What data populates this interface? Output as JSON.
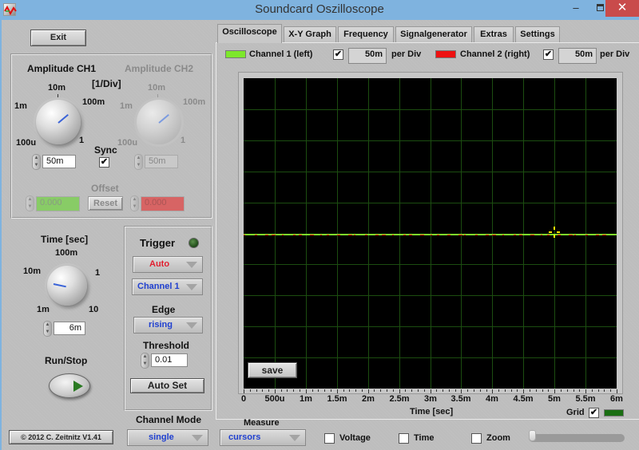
{
  "window": {
    "title": "Soundcard Oszilloscope",
    "minimize_glyph": "–",
    "close_glyph": "✕"
  },
  "left": {
    "exit_label": "Exit",
    "amplitude": {
      "ch1_title": "Amplitude CH1",
      "ch2_title": "Amplitude CH2",
      "unit_label": "[1/Div]",
      "knob_labels": [
        "100u",
        "1m",
        "10m",
        "100m",
        "1"
      ],
      "ch1_value": "50m",
      "ch2_value": "50m",
      "sync_label": "Sync",
      "sync_checked": true,
      "offset_label": "Offset",
      "offset_ch1": "0.000",
      "offset_ch2": "0.000",
      "reset_label": "Reset"
    },
    "time": {
      "title": "Time [sec]",
      "knob_labels": [
        "1m",
        "10m",
        "100m",
        "1",
        "10"
      ],
      "value": "6m"
    },
    "run_stop_label": "Run/Stop",
    "trigger": {
      "title": "Trigger",
      "mode": "Auto",
      "source": "Channel 1",
      "edge_label": "Edge",
      "edge": "rising",
      "threshold_label": "Threshold",
      "threshold": "0.01",
      "auto_set_label": "Auto Set"
    },
    "channel_mode_label": "Channel Mode",
    "channel_mode": "single",
    "copyright": "© 2012  C. Zeitnitz V1.41"
  },
  "tabs": [
    {
      "label": "Oscilloscope",
      "active": true
    },
    {
      "label": "X-Y Graph",
      "active": false
    },
    {
      "label": "Frequency",
      "active": false
    },
    {
      "label": "Signalgenerator",
      "active": false
    },
    {
      "label": "Extras",
      "active": false
    },
    {
      "label": "Settings",
      "active": false
    }
  ],
  "channels": {
    "ch1_label": "Channel 1 (left)",
    "ch1_color": "#7de82b",
    "ch1_enabled": true,
    "ch1_scale": "50m",
    "ch2_label": "Channel 2 (right)",
    "ch2_color": "#ee1111",
    "ch2_enabled": true,
    "ch2_scale": "50m",
    "per_div_label": "per Div"
  },
  "scope": {
    "save_label": "save",
    "x_axis_label": "Time [sec]",
    "x_ticks": [
      "0",
      "500u",
      "1m",
      "1.5m",
      "2m",
      "2.5m",
      "3m",
      "3.5m",
      "4m",
      "4.5m",
      "5m",
      "5.5m",
      "6m"
    ],
    "grid_label": "Grid",
    "grid_checked": true,
    "grid_color": "#1a6e12",
    "trigger_marker_time": "5m"
  },
  "measure": {
    "label": "Measure",
    "mode": "cursors",
    "voltage_label": "Voltage",
    "voltage_checked": false,
    "time_label": "Time",
    "time_checked": false,
    "zoom_label": "Zoom",
    "zoom_checked": false,
    "zoom_slider_value": 0
  }
}
